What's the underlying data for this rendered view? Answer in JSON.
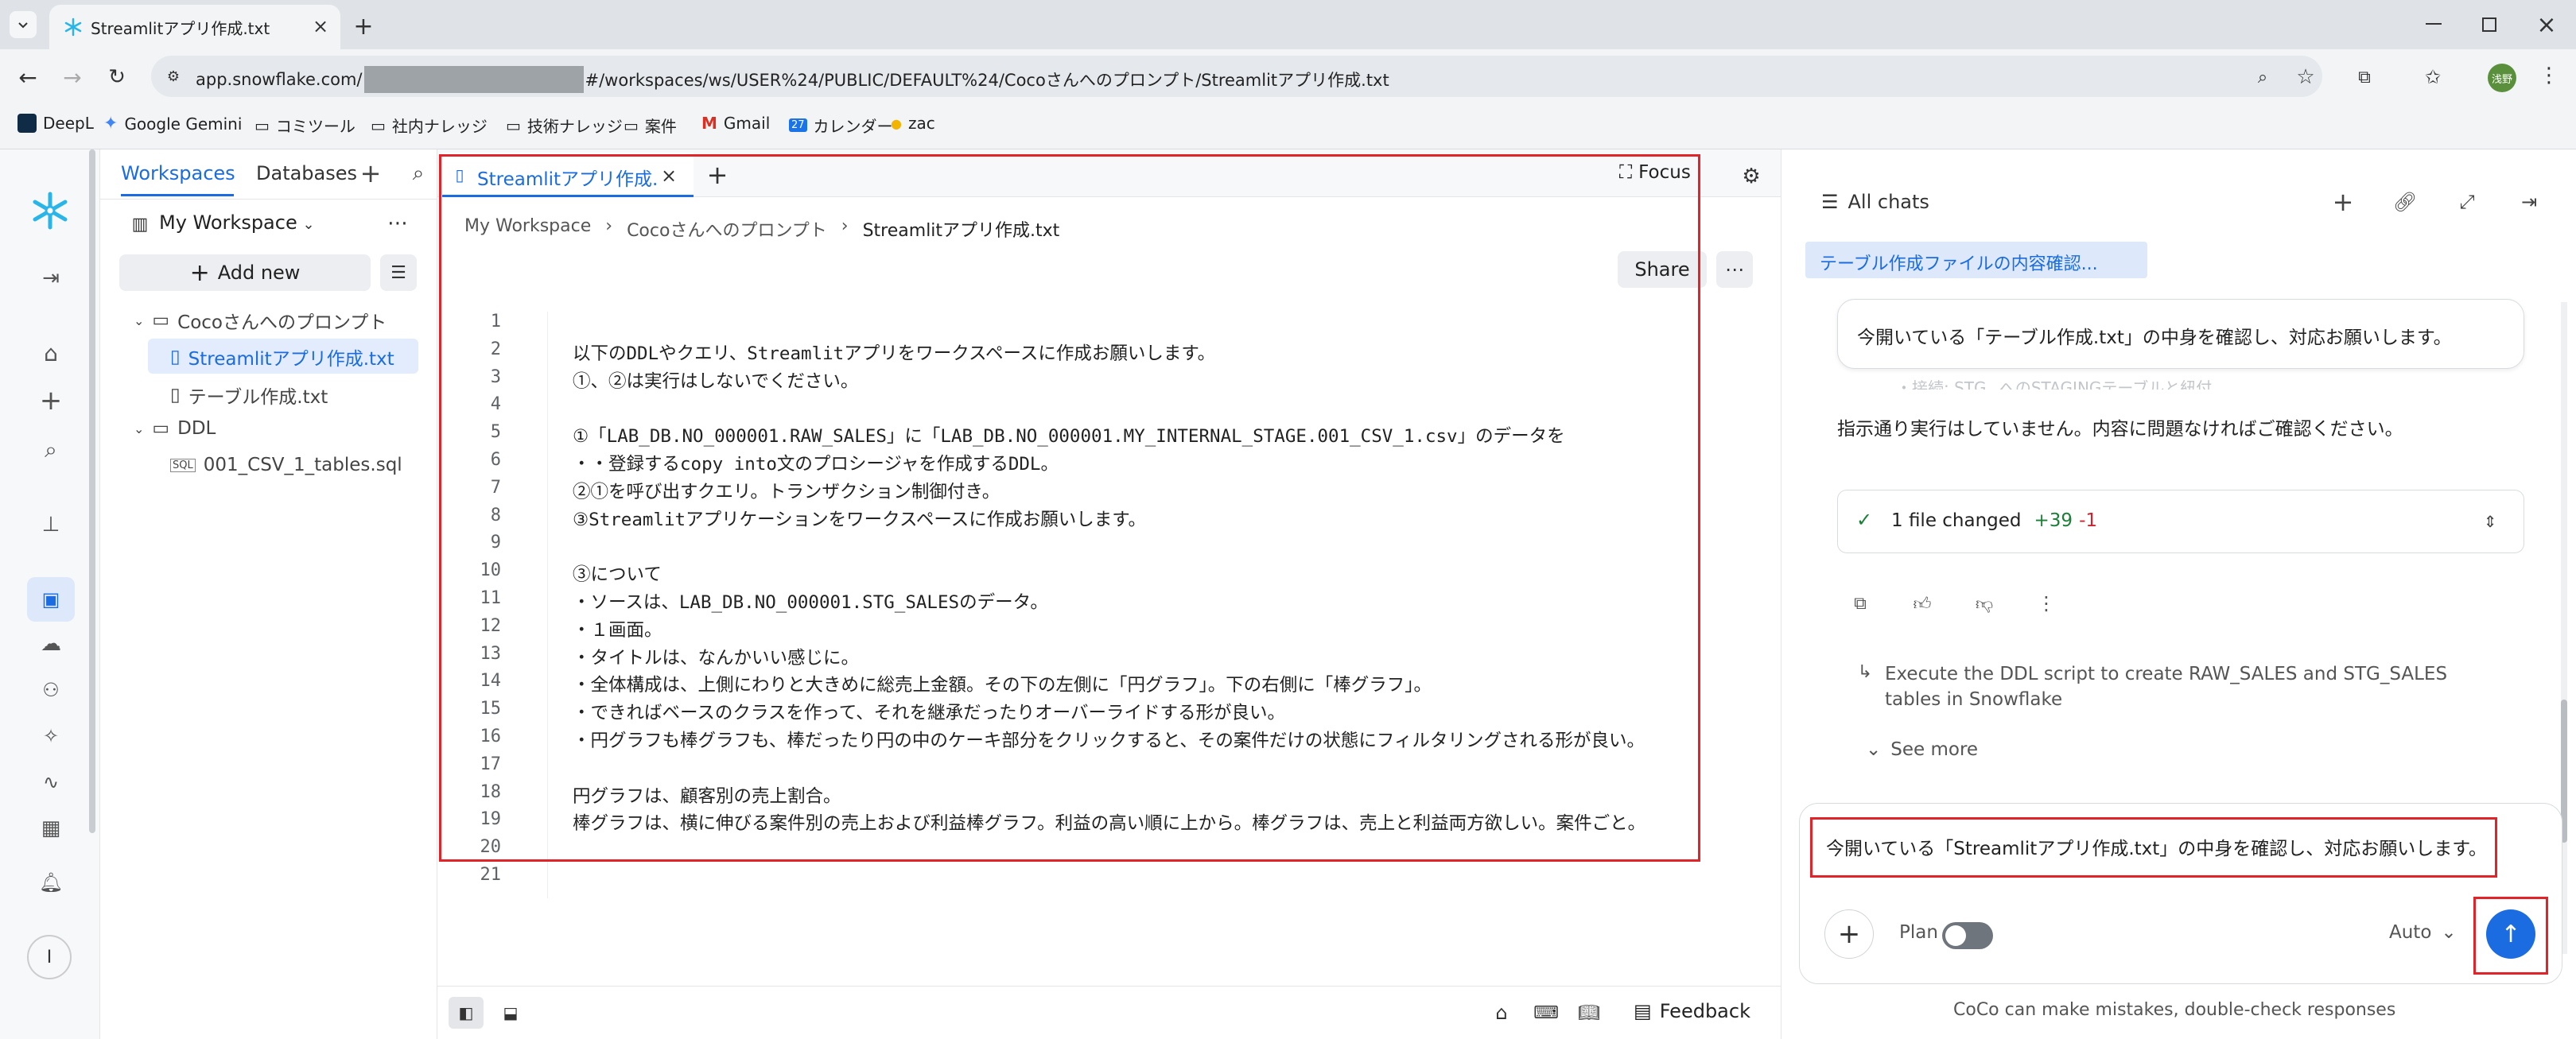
{
  "browser": {
    "tab_title": "Streamlitアプリ作成.txt",
    "url_host": "app.snowflake.com/",
    "url_path": "#/workspaces/ws/USER%24/PUBLIC/DEFAULT%24/Cocoさんへのプロンプト/Streamlitアプリ作成.txt",
    "bookmarks": [
      "DeepL",
      "Google Gemini",
      "コミツール",
      "社内ナレッジ",
      "技術ナレッジ",
      "案件",
      "Gmail",
      "カレンダー",
      "zac"
    ],
    "avatar_text": "浅野"
  },
  "sidebar": {
    "tab_workspaces": "Workspaces",
    "tab_databases": "Databases",
    "workspace_name": "My Workspace",
    "add_new": "Add new",
    "tree": [
      {
        "label": "Cocoさんへのプロンプト",
        "kind": "folder"
      },
      {
        "label": "Streamlitアプリ作成.txt",
        "kind": "file",
        "selected": true
      },
      {
        "label": "テーブル作成.txt",
        "kind": "file"
      },
      {
        "label": "DDL",
        "kind": "folder"
      },
      {
        "label": "001_CSV_1_tables.sql",
        "kind": "sql"
      }
    ],
    "user_initial": "I"
  },
  "editor": {
    "tab_title": "Streamlitアプリ作成.txt",
    "focus_label": "Focus",
    "breadcrumb": [
      "My Workspace",
      "Cocoさんへのプロンプト",
      "Streamlitアプリ作成.txt"
    ],
    "share_label": "Share",
    "lines": [
      "",
      "以下のDDLやクエリ、Streamlitアプリをワークスペースに作成お願いします。",
      "①、②は実行はしないでください。",
      "",
      "①「LAB_DB.NO_000001.RAW_SALES」に「LAB_DB.NO_000001.MY_INTERNAL_STAGE.001_CSV_1.csv」のデータを",
      "・・登録するcopy into文のプロシージャを作成するDDL。",
      "②①を呼び出すクエリ。トランザクション制御付き。",
      "③Streamlitアプリケーションをワークスペースに作成お願いします。",
      "",
      "③について",
      "・ソースは、LAB_DB.NO_000001.STG_SALESのデータ。",
      "・１画面。",
      "・タイトルは、なんかいい感じに。",
      "・全体構成は、上側にわりと大きめに総売上金額。その下の左側に「円グラフ」。下の右側に「棒グラフ」。",
      "・できればベースのクラスを作って、それを継承だったりオーバーライドする形が良い。",
      "・円グラフも棒グラフも、棒だったり円の中のケーキ部分をクリックすると、その案件だけの状態にフィルタリングされる形が良い。",
      "",
      "円グラフは、顧客別の売上割合。",
      "棒グラフは、横に伸びる案件別の売上および利益棒グラフ。利益の高い順に上から。棒グラフは、売上と利益両方欲しい。案件ごと。",
      "",
      ""
    ],
    "feedback_label": "Feedback"
  },
  "chat": {
    "all_chats": "All chats",
    "title_chip": "テーブル作成ファイルの内容確認...",
    "prev_user_msg": "今開いている「テーブル作成.txt」の中身を確認し、対応お願いします。",
    "faded_line": "・接続: STG_ へのSTAGINGテーブルと紐付",
    "assistant_msg": "指示通り実行はしていません。内容に問題なければご確認ください。",
    "files_changed": "1 file changed",
    "additions": "+39",
    "deletions": "-1",
    "suggestion": "Execute the DDL script to create RAW_SALES and STG_SALES tables in Snowflake",
    "see_more": "See more",
    "input_value": "今開いている「Streamlitアプリ作成.txt」の中身を確認し、対応お願いします。",
    "plan_label": "Plan",
    "model_label": "Auto",
    "disclaimer": "CoCo can make mistakes, double-check responses"
  },
  "colors": {
    "accent": "#1a6ce0",
    "snowflake": "#29b5e8",
    "highlight": "#e0242a",
    "add": "#1a7f37",
    "del": "#cf222e"
  }
}
